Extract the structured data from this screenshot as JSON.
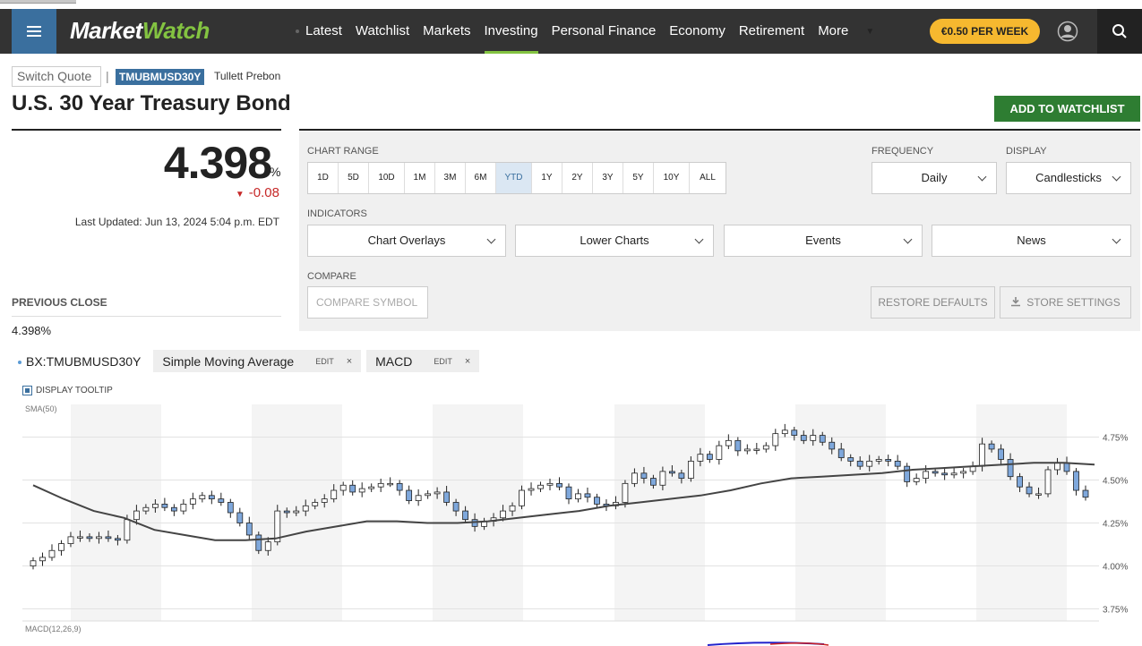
{
  "nav": {
    "logo_a": "Market",
    "logo_b": "Watch",
    "links": [
      "Latest",
      "Watchlist",
      "Markets",
      "Investing",
      "Personal Finance",
      "Economy",
      "Retirement",
      "More"
    ],
    "active_index": 3,
    "subscribe": "€0.50 PER WEEK",
    "brand_color": "#83c341"
  },
  "quote": {
    "switch_placeholder": "Switch Quote",
    "ticker": "TMUBMUSD30Y",
    "exchange": "Tullett Prebon",
    "title": "U.S. 30 Year Treasury Bond",
    "add_watchlist": "ADD TO WATCHLIST",
    "price": "4.398",
    "unit": "%",
    "change": "-0.08",
    "updated": "Last Updated: Jun 13, 2024 5:04 p.m. EDT",
    "prev_close_label": "PREVIOUS CLOSE",
    "prev_close_value": "4.398%"
  },
  "controls": {
    "chart_range_label": "CHART RANGE",
    "ranges": [
      "1D",
      "5D",
      "10D",
      "1M",
      "3M",
      "6M",
      "YTD",
      "1Y",
      "2Y",
      "3Y",
      "5Y",
      "10Y",
      "ALL"
    ],
    "selected_range": "YTD",
    "frequency_label": "FREQUENCY",
    "frequency": "Daily",
    "display_label": "DISPLAY",
    "display": "Candlesticks",
    "indicators_label": "INDICATORS",
    "indicators": [
      "Chart Overlays",
      "Lower Charts",
      "Events",
      "News"
    ],
    "compare_label": "COMPARE",
    "compare_placeholder": "COMPARE SYMBOL",
    "restore": "RESTORE DEFAULTS",
    "store": "STORE SETTINGS"
  },
  "legend": {
    "symbol": "BX:TMUBMUSD30Y",
    "sma": "Simple Moving Average",
    "macd": "MACD",
    "edit": "EDIT",
    "close": "×",
    "display_tooltip": "DISPLAY TOOLTIP"
  },
  "chart_data": {
    "type": "candlestick",
    "sma_label": "SMA(50)",
    "macd_label": "MACD(12,26,9)",
    "y_ticks": [
      "4.75%",
      "4.50%",
      "4.25%",
      "4.00%",
      "3.75%"
    ],
    "y_tick_values": [
      4.75,
      4.5,
      4.25,
      4.0,
      3.75
    ],
    "ylim": [
      3.68,
      4.94
    ],
    "up_color": "#ffffff",
    "down_color": "#7fa8dc",
    "closes": [
      4.03,
      4.05,
      4.09,
      4.13,
      4.17,
      4.17,
      4.16,
      4.17,
      4.16,
      4.15,
      4.27,
      4.32,
      4.34,
      4.36,
      4.34,
      4.32,
      4.36,
      4.39,
      4.41,
      4.39,
      4.37,
      4.31,
      4.25,
      4.18,
      4.09,
      4.14,
      4.32,
      4.31,
      4.32,
      4.35,
      4.37,
      4.39,
      4.44,
      4.47,
      4.43,
      4.45,
      4.46,
      4.48,
      4.48,
      4.44,
      4.38,
      4.41,
      4.42,
      4.43,
      4.37,
      4.32,
      4.27,
      4.23,
      4.26,
      4.28,
      4.32,
      4.35,
      4.44,
      4.45,
      4.47,
      4.48,
      4.46,
      4.39,
      4.42,
      4.4,
      4.36,
      4.35,
      4.37,
      4.48,
      4.54,
      4.51,
      4.47,
      4.55,
      4.54,
      4.51,
      4.61,
      4.65,
      4.62,
      4.7,
      4.73,
      4.67,
      4.68,
      4.68,
      4.7,
      4.77,
      4.79,
      4.76,
      4.73,
      4.76,
      4.72,
      4.68,
      4.63,
      4.61,
      4.58,
      4.61,
      4.62,
      4.61,
      4.58,
      4.49,
      4.51,
      4.55,
      4.54,
      4.53,
      4.54,
      4.55,
      4.58,
      4.71,
      4.68,
      4.62,
      4.52,
      4.46,
      4.42,
      4.42,
      4.56,
      4.6,
      4.55,
      4.44,
      4.4
    ],
    "sma": [
      4.47,
      4.39,
      4.32,
      4.28,
      4.21,
      4.18,
      4.15,
      4.15,
      4.16,
      4.2,
      4.23,
      4.26,
      4.26,
      4.25,
      4.25,
      4.26,
      4.28,
      4.3,
      4.32,
      4.35,
      4.37,
      4.39,
      4.41,
      4.44,
      4.48,
      4.51,
      4.52,
      4.53,
      4.54,
      4.56,
      4.57,
      4.58,
      4.59,
      4.6,
      4.6,
      4.59
    ],
    "sma_start_index": 0
  }
}
